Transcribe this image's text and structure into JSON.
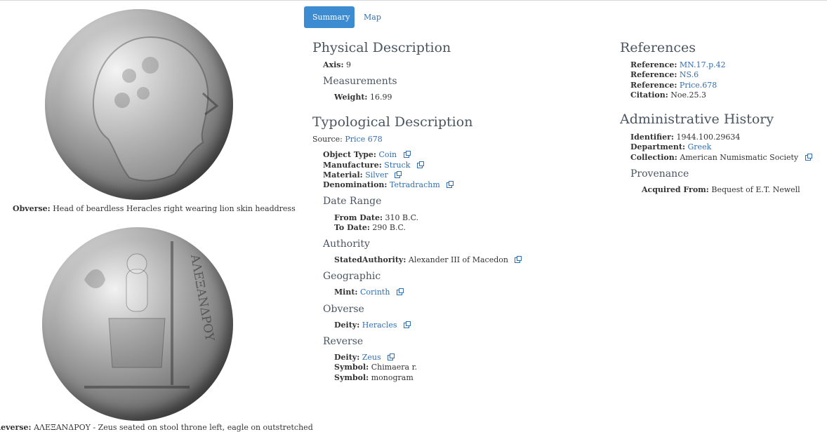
{
  "tabs": {
    "summary": "Summary",
    "map": "Map"
  },
  "obverse": {
    "label": "Obverse:",
    "text": "Head of beardless Heracles right wearing lion skin headdress"
  },
  "reverse": {
    "label": "Reverse:",
    "text": "ΑΛΕΞΑΝΔΡΟΥ - Zeus seated on stool throne left, eagle on outstretched"
  },
  "physical": {
    "title": "Physical Description",
    "axis_label": "Axis:",
    "axis_value": "9",
    "measurements_title": "Measurements",
    "weight_label": "Weight:",
    "weight_value": "16.99"
  },
  "typological": {
    "title": "Typological Description",
    "source_label": "Source:",
    "source_value": "Price 678",
    "object_type_label": "Object Type:",
    "object_type_value": "Coin",
    "manufacture_label": "Manufacture:",
    "manufacture_value": "Struck",
    "material_label": "Material:",
    "material_value": "Silver",
    "denomination_label": "Denomination:",
    "denomination_value": "Tetradrachm",
    "date_range_title": "Date Range",
    "from_label": "From Date:",
    "from_value": "310 B.C.",
    "to_label": "To Date:",
    "to_value": "290 B.C.",
    "authority_title": "Authority",
    "stated_authority_label": "StatedAuthority:",
    "stated_authority_value": "Alexander III of Macedon",
    "geographic_title": "Geographic",
    "mint_label": "Mint:",
    "mint_value": "Corinth",
    "obverse_title": "Obverse",
    "obv_deity_label": "Deity:",
    "obv_deity_value": "Heracles",
    "reverse_title": "Reverse",
    "rev_deity_label": "Deity:",
    "rev_deity_value": "Zeus",
    "symbol1_label": "Symbol:",
    "symbol1_value": "Chimaera r.",
    "symbol2_label": "Symbol:",
    "symbol2_value": "monogram"
  },
  "references": {
    "title": "References",
    "items": [
      {
        "label": "Reference:",
        "value": "MN.17.p.42"
      },
      {
        "label": "Reference:",
        "value": "NS.6"
      },
      {
        "label": "Reference:",
        "value": "Price.678"
      }
    ],
    "citation_label": "Citation:",
    "citation_value": "Noe.25.3"
  },
  "admin": {
    "title": "Administrative History",
    "identifier_label": "Identifier:",
    "identifier_value": "1944.100.29634",
    "department_label": "Department:",
    "department_value": "Greek",
    "collection_label": "Collection:",
    "collection_value": "American Numismatic Society",
    "provenance_title": "Provenance",
    "acquired_label": "Acquired From:",
    "acquired_value": "Bequest of E.T. Newell"
  },
  "icons": {
    "external_link": "external-link-icon"
  },
  "colors": {
    "link": "#2f6fb0",
    "tab_active": "#3d8bd1",
    "heading": "#4a5560"
  }
}
